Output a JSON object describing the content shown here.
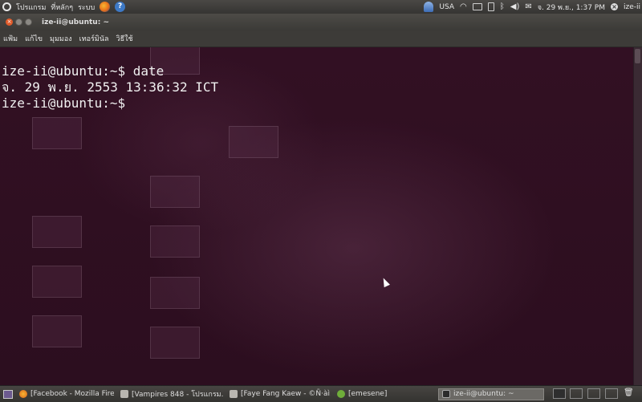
{
  "top_panel": {
    "menus": [
      "โปรแกรม",
      "ที่หลักๆ",
      "ระบบ"
    ],
    "keyboard_layout": "USA",
    "datetime": "จ. 29 พ.ย., 1:37 PM",
    "user": "ize-ii"
  },
  "window": {
    "title": "ize-ii@ubuntu: ~",
    "menu": [
      "แฟ้ม",
      "แก้ไข",
      "มุมมอง",
      "เทอร์มินัล",
      "วิธีใช้"
    ]
  },
  "terminal": {
    "lines": [
      "ize-ii@ubuntu:~$ date",
      "จ. 29 พ.ย. 2553 13:36:32 ICT",
      "ize-ii@ubuntu:~$"
    ]
  },
  "taskbar": {
    "tasks": [
      {
        "label": "[Facebook - Mozilla Firef...",
        "icon": "firefox-icon"
      },
      {
        "label": "[Vampires 848 - โปรแกรม...",
        "icon": "document-icon"
      },
      {
        "label": "[Faye Fang Kaew - ©Ñ·àì...",
        "icon": "document-icon"
      },
      {
        "label": "[emesene]",
        "icon": "emesene-icon"
      },
      {
        "label": "ize-ii@ubuntu: ~",
        "icon": "terminal-icon",
        "active": true
      }
    ]
  }
}
